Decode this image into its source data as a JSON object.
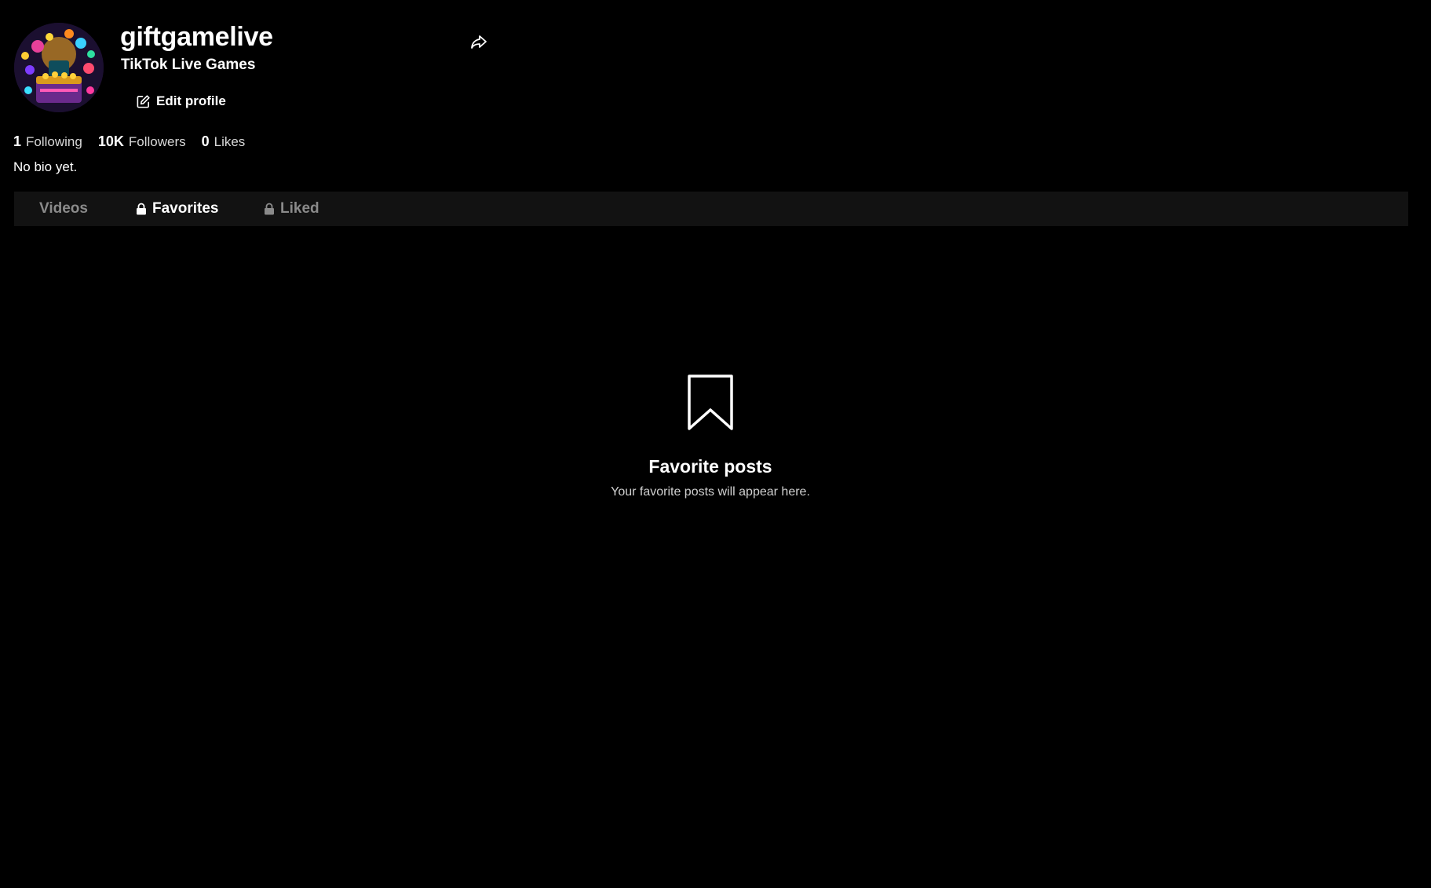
{
  "profile": {
    "username": "giftgamelive",
    "nickname": "TikTok Live Games",
    "edit_label": "Edit profile",
    "bio": "No bio yet."
  },
  "stats": [
    {
      "value": "1",
      "label": "Following"
    },
    {
      "value": "10K",
      "label": "Followers"
    },
    {
      "value": "0",
      "label": "Likes"
    }
  ],
  "tabs": [
    {
      "label": "Videos",
      "active": false,
      "locked": false
    },
    {
      "label": "Favorites",
      "active": true,
      "locked": true
    },
    {
      "label": "Liked",
      "active": false,
      "locked": true
    }
  ],
  "empty_state": {
    "icon": "bookmark-icon",
    "title": "Favorite posts",
    "subtitle": "Your favorite posts will appear here."
  },
  "colors": {
    "background": "#000000",
    "tabbar": "#121212",
    "inactive_tab": "#8a8a8a",
    "text": "#ffffff"
  }
}
